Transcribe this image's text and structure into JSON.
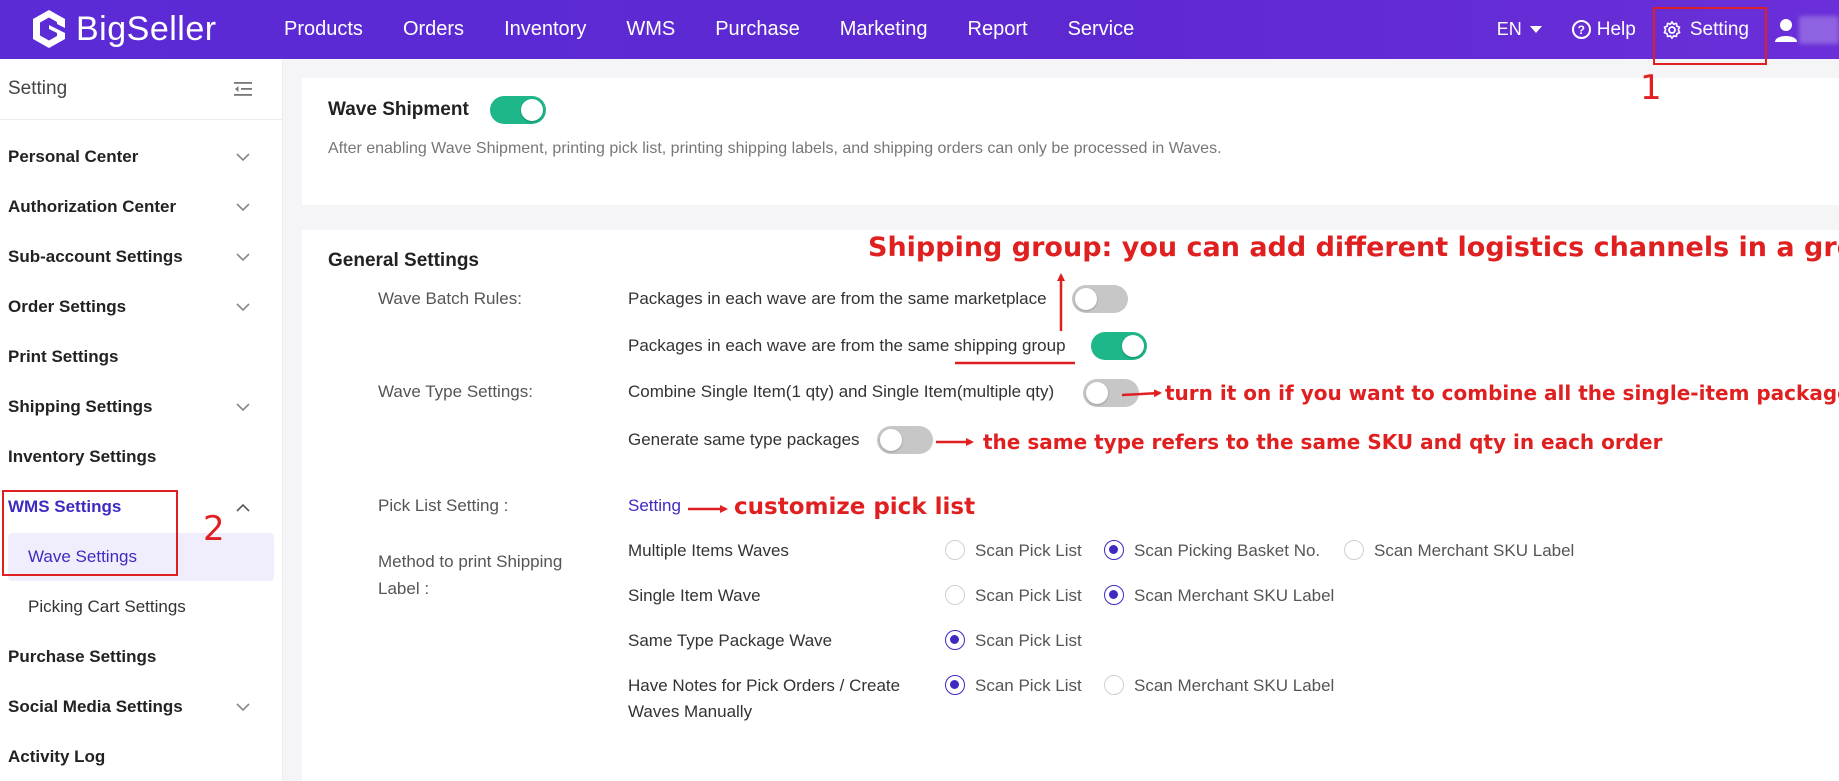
{
  "brand": {
    "name": "BigSeller"
  },
  "nav": [
    "Products",
    "Orders",
    "Inventory",
    "WMS",
    "Purchase",
    "Marketing",
    "Report",
    "Service"
  ],
  "top_right": {
    "language": "EN",
    "help": "Help",
    "setting": "Setting"
  },
  "sidebar": {
    "title": "Setting",
    "items": [
      {
        "label": "Personal Center",
        "expandable": true
      },
      {
        "label": "Authorization Center",
        "expandable": true
      },
      {
        "label": "Sub-account Settings",
        "expandable": true
      },
      {
        "label": "Order Settings",
        "expandable": true
      },
      {
        "label": "Print Settings",
        "expandable": false
      },
      {
        "label": "Shipping Settings",
        "expandable": true
      },
      {
        "label": "Inventory Settings",
        "expandable": false
      },
      {
        "label": "WMS Settings",
        "expandable": true,
        "expanded": true,
        "active": true
      },
      {
        "label": "Purchase Settings",
        "expandable": false
      },
      {
        "label": "Social Media Settings",
        "expandable": true
      },
      {
        "label": "Activity Log",
        "expandable": false
      }
    ],
    "sub_items": [
      {
        "label": "Wave Settings",
        "active": true
      },
      {
        "label": "Picking Cart Settings",
        "active": false
      }
    ]
  },
  "wave_shipment": {
    "title": "Wave Shipment",
    "enabled": true,
    "description": "After enabling Wave Shipment, printing pick list, printing shipping labels, and shipping orders can only be processed in Waves."
  },
  "general": {
    "title": "General Settings",
    "batch_label": "Wave Batch Rules:",
    "batch_opt1": "Packages in each wave are from the same marketplace",
    "batch_opt1_on": false,
    "batch_opt2": "Packages in each wave are from the same shipping group",
    "batch_opt2_on": true,
    "type_label": "Wave Type Settings:",
    "type_opt1": "Combine Single Item(1 qty) and Single Item(multiple qty)",
    "type_opt1_on": false,
    "type_opt2": "Generate same type packages",
    "type_opt2_on": false,
    "pick_label": "Pick List Setting :",
    "pick_link": "Setting",
    "method_label_1": "Method to print Shipping",
    "method_label_2": "Label :",
    "methods": [
      {
        "name": "Multiple Items Waves",
        "options": [
          "Scan Pick List",
          "Scan Picking Basket No.",
          "Scan Merchant SKU Label"
        ],
        "selected": 1
      },
      {
        "name": "Single Item Wave",
        "options": [
          "Scan Pick List",
          "Scan Merchant SKU Label"
        ],
        "selected": 1
      },
      {
        "name": "Same Type Package Wave",
        "options": [
          "Scan Pick List"
        ],
        "selected": 0
      },
      {
        "name_1": "Have Notes for Pick Orders / Create",
        "name_2": "Waves Manually",
        "options": [
          "Scan Pick List",
          "Scan Merchant SKU Label"
        ],
        "selected": 0
      }
    ]
  },
  "annotations": {
    "shipping_group": "Shipping group: you can add different logistics channels in a group",
    "combine": "turn it on if you want to combine all the single-item packages",
    "same_type": "the same type refers to the same SKU and qty in each order",
    "pick_list": "customize pick list",
    "num1": "1",
    "num2": "2",
    "color": "#e02020"
  },
  "colors": {
    "brand": "#5b2bd6",
    "accent": "#3d2bc1",
    "toggle_on": "#1eb78a",
    "toggle_off": "#c7c7c7"
  }
}
